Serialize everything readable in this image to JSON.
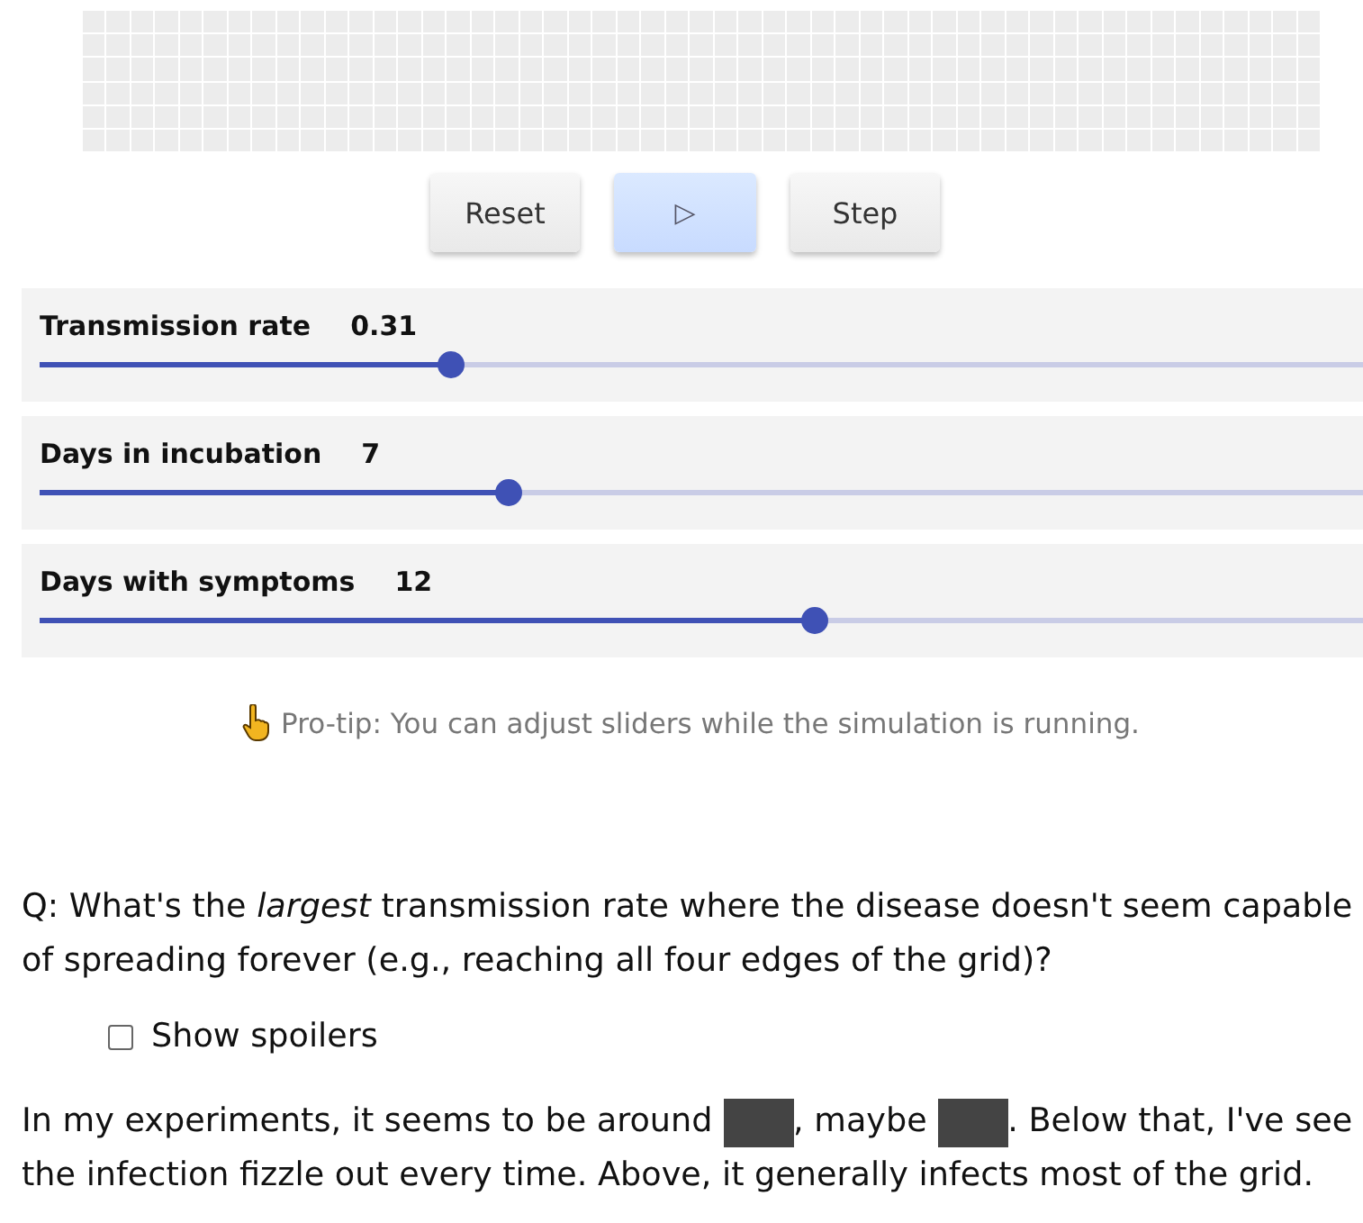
{
  "buttons": [
    {
      "kind": "text",
      "label": "Reset",
      "selected": false
    },
    {
      "kind": "play",
      "label": "▷",
      "selected": true
    },
    {
      "kind": "text",
      "label": "Step",
      "selected": false
    }
  ],
  "sliders": [
    {
      "name": "Transmission rate",
      "reading": "0.31",
      "level": 0.31
    },
    {
      "name": "Days in incubation",
      "reading": "7",
      "level": 0.354
    },
    {
      "name": "Days with symptoms",
      "reading": "12",
      "level": 0.585
    }
  ],
  "tip": "Pro-tip: You can adjust sliders while the simulation is running.",
  "question": "Q: What's the *largest* transmission rate where the disease doesn't seem capable of spreading forever (e.g., reaching all four edges of the grid)?",
  "spoiler_toggle": {
    "label": "Show spoilers",
    "checked": false
  },
  "answer_lines": [
    [
      {
        "kind": "text",
        "text": "In my experiments, it seems to be around "
      },
      {
        "kind": "redacted"
      },
      {
        "kind": "text",
        "text": ", maybe "
      },
      {
        "kind": "redacted"
      },
      {
        "kind": "text",
        "text": ". Below that, I've see"
      }
    ],
    [
      {
        "kind": "text",
        "text": "the infection fizzle out every time. Above, it generally infects most of the grid."
      }
    ]
  ]
}
